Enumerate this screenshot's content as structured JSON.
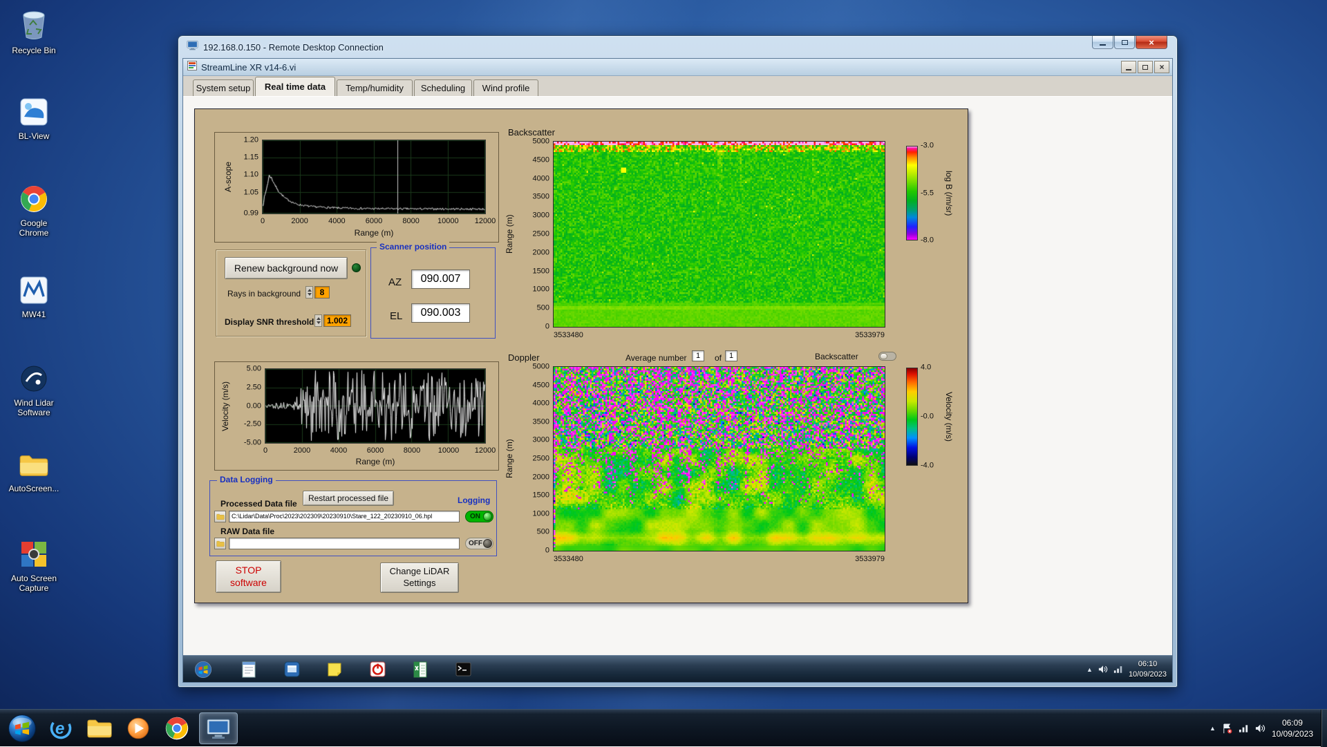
{
  "colors": {
    "panel_tan": "#c6b28c",
    "group_label_blue": "#1830c0",
    "stop_red": "#cc0000",
    "on_green": "#00b400",
    "orange_value_bg": "#ffa200"
  },
  "desktop": {
    "icons": [
      {
        "label": "Recycle Bin"
      },
      {
        "label": "BL-View"
      },
      {
        "label": "Google Chrome"
      },
      {
        "label": "MW41"
      },
      {
        "label": "Wind Lidar Software"
      },
      {
        "label": "AutoScreen..."
      },
      {
        "label": "Auto Screen Capture"
      }
    ],
    "tray": {
      "time": "06:09",
      "date": "10/09/2023"
    }
  },
  "rdp": {
    "title": "192.168.0.150 - Remote Desktop Connection"
  },
  "app": {
    "title": "StreamLine XR v14-6.vi",
    "active_tab": "Real time data",
    "tabs": [
      {
        "label": "System setup"
      },
      {
        "label": "Real time data"
      },
      {
        "label": "Temp/humidity"
      },
      {
        "label": "Scheduling"
      },
      {
        "label": "Wind profile"
      }
    ],
    "background_group": {
      "renew_button": "Renew background now",
      "rays_label": "Rays in background",
      "rays_value": "8",
      "snr_label": "Display SNR threshold",
      "snr_value": "1.002"
    },
    "scanner": {
      "group_label": "Scanner position",
      "az_label": "AZ",
      "az_value": "090.007",
      "el_label": "EL",
      "el_value": "090.003"
    },
    "doppler_header": {
      "average_label": "Average number",
      "average_value": "1",
      "of_label": "of",
      "average_count": "1",
      "toggle_label": "Backscatter"
    },
    "data_logging": {
      "group_label": "Data Logging",
      "processed_label": "Processed Data file",
      "restart_button": "Restart processed file",
      "logging_label": "Logging",
      "processed_path": "C:\\Lidar\\Data\\Proc\\2023\\202309\\20230910\\Stare_122_20230910_06.hpl",
      "on_label": "ON",
      "raw_label": "RAW Data file",
      "raw_path": "",
      "off_label": "OFF"
    },
    "stop_button_line1": "STOP",
    "stop_button_line2": "software",
    "settings_button_line1": "Change LiDAR",
    "settings_button_line2": "Settings",
    "remote_tray": {
      "time": "06:10",
      "date": "10/09/2023"
    }
  },
  "chart_data": [
    {
      "id": "ascope",
      "type": "line",
      "ylabel": "A-scope",
      "xlabel": "Range (m)",
      "xlim": [
        0,
        12000
      ],
      "ylim": [
        0.99,
        1.2
      ],
      "x_ticks": [
        "0",
        "2000",
        "4000",
        "6000",
        "8000",
        "10000",
        "12000"
      ],
      "y_ticks": [
        "1.20",
        "1.15",
        "1.10",
        "1.05",
        "0.99"
      ],
      "bg": "#000000",
      "grid": "#1b3a1b",
      "line_color": "#f2f2f2",
      "noise_amp": 0.003,
      "cursor_x": 7300,
      "series": [
        {
          "name": "a-scope",
          "points": [
            [
              0,
              1.015
            ],
            [
              150,
              1.05
            ],
            [
              350,
              1.1
            ],
            [
              550,
              1.082
            ],
            [
              800,
              1.055
            ],
            [
              1200,
              1.032
            ],
            [
              1800,
              1.015
            ],
            [
              2600,
              1.008
            ],
            [
              4000,
              1.004
            ],
            [
              6000,
              1.002
            ],
            [
              8000,
              1.0015
            ],
            [
              12000,
              1.001
            ]
          ]
        }
      ],
      "description": "White trace peaking at ~1.10 near 350 m then decaying to ~1.00 baseline; vertical cursor line at ~7300 m; grid on"
    },
    {
      "id": "velocity",
      "type": "line",
      "ylabel": "Velocity (m/s)",
      "xlabel": "Range (m)",
      "xlim": [
        0,
        12000
      ],
      "ylim": [
        -5,
        5
      ],
      "x_ticks": [
        "0",
        "2000",
        "4000",
        "6000",
        "8000",
        "10000",
        "12000"
      ],
      "y_ticks": [
        "5.00",
        "2.50",
        "0.00",
        "-2.50",
        "-5.00"
      ],
      "bg": "#000000",
      "grid": "#1b3a1b",
      "line_color": "#f2f2f2",
      "description": "Velocity near 0 m/s with small scatter below ~1500 m, growing to full-scale ±5 m/s random noise spikes from ~2000 m to 12000 m; grid on"
    },
    {
      "id": "backscatter",
      "type": "heatmap",
      "title": "Backscatter",
      "ylabel": "Range (m)",
      "ylim": [
        0,
        5000
      ],
      "y_ticks": [
        "5000",
        "4500",
        "4000",
        "3500",
        "3000",
        "2500",
        "2000",
        "1500",
        "1000",
        "500",
        "0"
      ],
      "x_ticks": [
        "3533480",
        "3533979"
      ],
      "colorbar": {
        "label": "log B (/m/sr)",
        "ticks": [
          "-3.0",
          "-5.5",
          "-8.0"
        ],
        "range": [
          -8,
          -3
        ]
      },
      "cmap": [
        [
          0,
          "#ff00ff"
        ],
        [
          0.06,
          "#9000e0"
        ],
        [
          0.14,
          "#2020ff"
        ],
        [
          0.24,
          "#0088dd"
        ],
        [
          0.32,
          "#00a070"
        ],
        [
          0.42,
          "#00b020"
        ],
        [
          0.52,
          "#22c800"
        ],
        [
          0.62,
          "#74dc00"
        ],
        [
          0.72,
          "#c4ee00"
        ],
        [
          0.8,
          "#ffff00"
        ],
        [
          0.88,
          "#ff9000"
        ],
        [
          0.94,
          "#ff2000"
        ],
        [
          0.98,
          "#ff10a0"
        ],
        [
          1,
          "#ffb0f0"
        ]
      ],
      "description": "Uniform green speckle (~-5.5 log B) over most of the time-height field; yellow/orange/red noisy band at the very top near 5000 m; smoother brighter green layer below ~600 m with a light band near 500 m"
    },
    {
      "id": "doppler",
      "type": "heatmap",
      "title": "Doppler",
      "ylabel": "Range (m)",
      "ylim": [
        0,
        5000
      ],
      "y_ticks": [
        "5000",
        "4500",
        "4000",
        "3500",
        "3000",
        "2500",
        "2000",
        "1500",
        "1000",
        "500",
        "0"
      ],
      "x_ticks": [
        "3533480",
        "3533979"
      ],
      "colorbar": {
        "label": "Velocity (m/s)",
        "ticks": [
          "4.0",
          "-0.0",
          "-4.0"
        ],
        "range": [
          -4,
          4
        ]
      },
      "cmap": [
        [
          0,
          "#101010"
        ],
        [
          0.08,
          "#000070"
        ],
        [
          0.18,
          "#0010e0"
        ],
        [
          0.28,
          "#0090ff"
        ],
        [
          0.38,
          "#00c080"
        ],
        [
          0.47,
          "#00c818"
        ],
        [
          0.56,
          "#66d800"
        ],
        [
          0.66,
          "#c8e800"
        ],
        [
          0.76,
          "#ffcc00"
        ],
        [
          0.86,
          "#ff6600"
        ],
        [
          0.94,
          "#dd1100"
        ],
        [
          1,
          "#880000"
        ]
      ],
      "out_of_range_colors": [
        "#ff00ff",
        "#e818e0",
        "#ff44f4"
      ],
      "description": "Magenta/rainbow random noise with vertical streaks above ~2800 m, green field with yellow-orange patches between ~1000-2800 m, smooth green/yellow wisps and orange layers below ~1000 m"
    }
  ]
}
